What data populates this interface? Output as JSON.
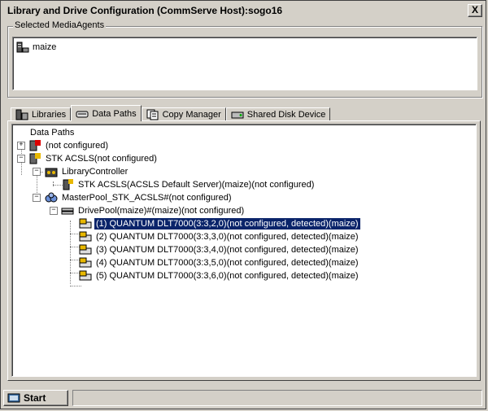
{
  "window": {
    "title": "Library and Drive Configuration (CommServe Host):sogo16",
    "close_label": "X"
  },
  "media_agents": {
    "legend": "Selected MediaAgents",
    "items": [
      "maize"
    ]
  },
  "tabs": [
    {
      "label": "Libraries",
      "icon": "library-icon"
    },
    {
      "label": "Data Paths",
      "icon": "tape-icon"
    },
    {
      "label": "Copy Manager",
      "icon": "copy-icon"
    },
    {
      "label": "Shared Disk Device",
      "icon": "disk-icon"
    }
  ],
  "active_tab": "Data Paths",
  "tree": {
    "root": "Data Paths",
    "nodes": [
      "(not configured)",
      "STK ACSLS(not configured)",
      "LibraryController",
      "STK ACSLS(ACSLS Default Server)(maize)(not configured)",
      "MasterPool_STK_ACSLS#(not configured)",
      "DrivePool(maize)#(maize)(not configured)",
      "(1) QUANTUM DLT7000(3:3,2,0)(not configured, detected)(maize)",
      "(2) QUANTUM DLT7000(3:3,3,0)(not configured, detected)(maize)",
      "(3) QUANTUM DLT7000(3:3,4,0)(not configured, detected)(maize)",
      "(4) QUANTUM DLT7000(3:3,5,0)(not configured, detected)(maize)",
      "(5) QUANTUM DLT7000(3:3,6,0)(not configured, detected)(maize)"
    ],
    "selected_index": 6
  },
  "statusbar": {
    "start_label": "Start",
    "status_text": ""
  }
}
